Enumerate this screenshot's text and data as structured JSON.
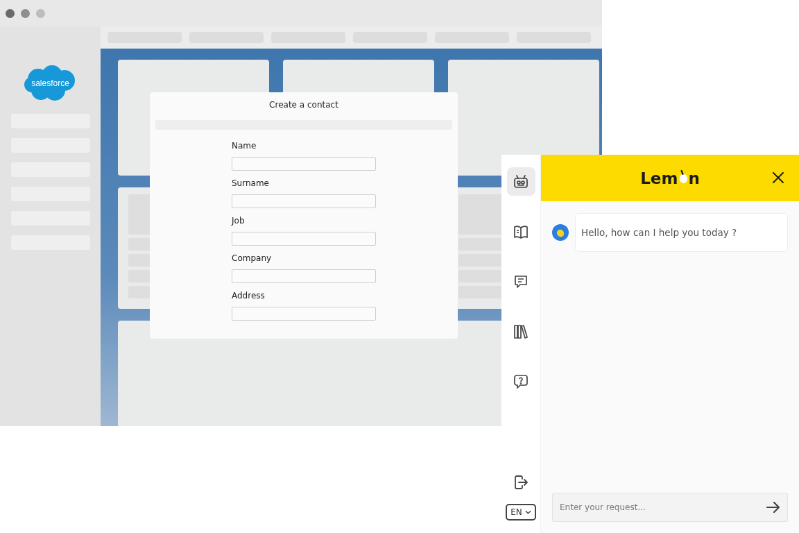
{
  "browser": {
    "logo_text": "salesforce",
    "dialog": {
      "title": "Create a contact",
      "fields": [
        {
          "label": "Name"
        },
        {
          "label": "Surname"
        },
        {
          "label": "Job"
        },
        {
          "label": "Company"
        },
        {
          "label": "Address"
        }
      ]
    }
  },
  "assistant": {
    "logo": {
      "before": "Lem",
      "after": "n"
    },
    "nav": [
      {
        "kind": "robot",
        "selected": true
      },
      {
        "kind": "book",
        "selected": false
      },
      {
        "kind": "chat",
        "selected": false
      },
      {
        "kind": "library",
        "selected": false
      },
      {
        "kind": "help",
        "selected": false
      }
    ],
    "language": "EN",
    "messages": [
      "Hello, how can I help you today ?"
    ],
    "input": {
      "placeholder": "Enter your request..."
    }
  }
}
